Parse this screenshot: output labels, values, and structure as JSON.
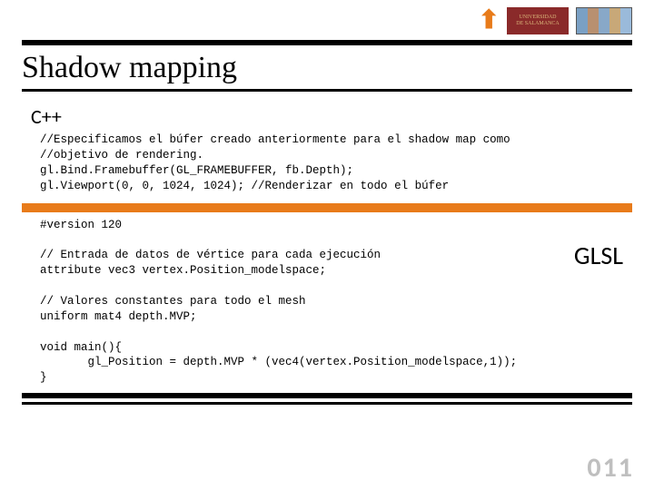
{
  "header": {
    "arrow_icon": "⬆",
    "uni_logo_text": "UNIVERSIDAD",
    "uni_logo_text2": "DE SALAMANCA"
  },
  "title": "Shadow mapping",
  "cpp": {
    "label": "C++",
    "code": "//Especificamos el búfer creado anteriormente para el shadow map como\n//objetivo de rendering.\ngl.Bind.Framebuffer(GL_FRAMEBUFFER, fb.Depth);\ngl.Viewport(0, 0, 1024, 1024); //Renderizar en todo el búfer"
  },
  "glsl": {
    "label": "GLSL",
    "code": "#version 120\n\n// Entrada de datos de vértice para cada ejecución\nattribute vec3 vertex.Position_modelspace;\n\n// Valores constantes para todo el mesh\nuniform mat4 depth.MVP;\n\nvoid main(){\n       gl_Position = depth.MVP * (vec4(vertex.Position_modelspace,1));\n}"
  },
  "page_number": "011"
}
